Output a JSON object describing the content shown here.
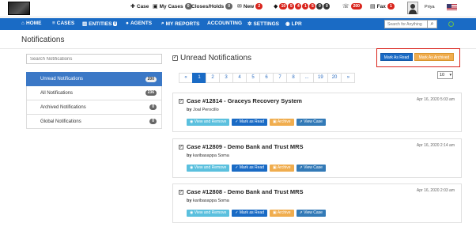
{
  "topbar": {
    "case_label": "Case",
    "my_cases_label": "My Cases",
    "my_cases_count": "0",
    "closes_holds_label": "Closes/Holds",
    "closes_holds_count": "0",
    "new_label": "New",
    "new_count": "2",
    "alert_counts": [
      "10",
      "5",
      "4",
      "1",
      "5",
      "0",
      "0"
    ],
    "phone_count": "200",
    "fax_label": "Fax",
    "fax_count": "1",
    "user_name": "Priya"
  },
  "nav": {
    "items": [
      "HOME",
      "CASES",
      "ENTITIES",
      "AGENTS",
      "MY REPORTS",
      "ACCOUNTING",
      "SETTINGS",
      "LPR"
    ],
    "entities_count": "0",
    "search_placeholder": "Search for Anything",
    "accent": "#1a6bc5"
  },
  "page": {
    "title": "Notifications"
  },
  "sidebar": {
    "search_placeholder": "Search Notifications",
    "items": [
      {
        "label": "Unread Notifications",
        "count": "200"
      },
      {
        "label": "All Notifications",
        "count": "236"
      },
      {
        "label": "Archived Notifications",
        "count": "0"
      },
      {
        "label": "Global Notifications",
        "count": "0"
      }
    ]
  },
  "main": {
    "title": "Unread Notifications",
    "mark_as_read": "Mark As Read",
    "mark_as_archived": "Mark As Archived",
    "per_page": "10",
    "pagination": [
      "«",
      "1",
      "2",
      "3",
      "4",
      "5",
      "6",
      "7",
      "8",
      "...",
      "19",
      "20",
      "»"
    ]
  },
  "notifications": [
    {
      "title": "Case #12814 - Graceys Recovery System",
      "by_prefix": "by",
      "author": "Joal Perocillo",
      "date": "Apr 16, 2020 5:03 am",
      "actions": [
        "View and Remove",
        "Mark as Read",
        "Archive",
        "View Case"
      ]
    },
    {
      "title": "Case #12809 - Demo Bank and Trust MRS",
      "by_prefix": "by",
      "author": "karibasappa Soma",
      "date": "Apr 16, 2020 2:14 am",
      "actions": [
        "View and Remove",
        "Mark as Read",
        "Archive",
        "View Case"
      ]
    },
    {
      "title": "Case #12808 - Demo Bank and Trust MRS",
      "by_prefix": "by",
      "author": "karibasappa Soma",
      "date": "Apr 16, 2020 2:03 am",
      "actions": [
        "View and Remove",
        "Mark as Read",
        "Archive",
        "View Case"
      ]
    }
  ]
}
